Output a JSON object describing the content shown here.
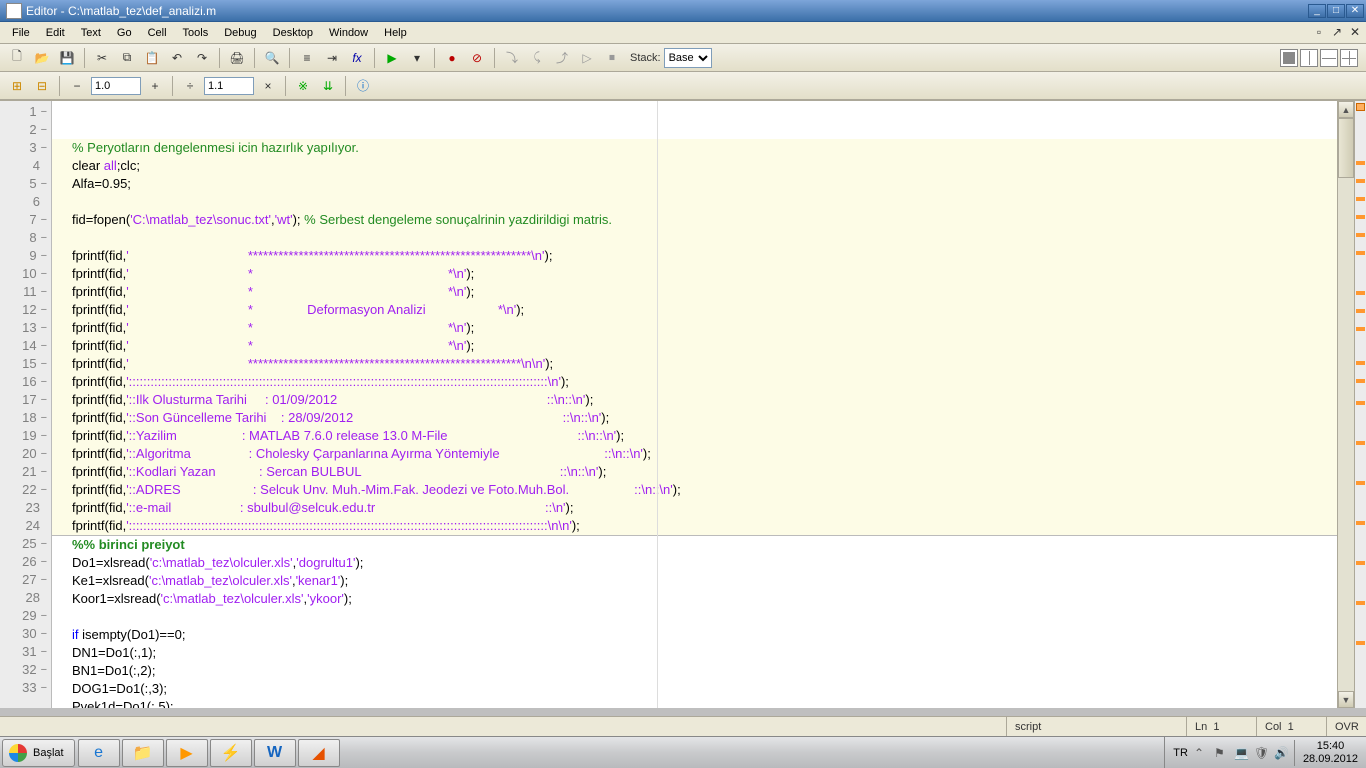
{
  "window": {
    "title": "Editor - C:\\matlab_tez\\def_analizi.m"
  },
  "menu": {
    "items": [
      "File",
      "Edit",
      "Text",
      "Go",
      "Cell",
      "Tools",
      "Debug",
      "Desktop",
      "Window",
      "Help"
    ]
  },
  "toolbar1": {
    "stack_label": "Stack:",
    "stack_value": "Base"
  },
  "toolbar2": {
    "zoom1": "1.0",
    "zoom2": "1.1"
  },
  "gutter": {
    "lines": [
      {
        "n": "1",
        "dash": true
      },
      {
        "n": "2",
        "dash": true
      },
      {
        "n": "3",
        "dash": true
      },
      {
        "n": "4",
        "dash": false
      },
      {
        "n": "5",
        "dash": true
      },
      {
        "n": "6",
        "dash": false
      },
      {
        "n": "7",
        "dash": true
      },
      {
        "n": "8",
        "dash": true
      },
      {
        "n": "9",
        "dash": true
      },
      {
        "n": "10",
        "dash": true
      },
      {
        "n": "11",
        "dash": true
      },
      {
        "n": "12",
        "dash": true
      },
      {
        "n": "13",
        "dash": true
      },
      {
        "n": "14",
        "dash": true
      },
      {
        "n": "15",
        "dash": true
      },
      {
        "n": "16",
        "dash": true
      },
      {
        "n": "17",
        "dash": true
      },
      {
        "n": "18",
        "dash": true
      },
      {
        "n": "19",
        "dash": true
      },
      {
        "n": "20",
        "dash": true
      },
      {
        "n": "21",
        "dash": true
      },
      {
        "n": "22",
        "dash": true
      },
      {
        "n": "23",
        "dash": false
      },
      {
        "n": "24",
        "dash": false
      },
      {
        "n": "25",
        "dash": true
      },
      {
        "n": "26",
        "dash": true
      },
      {
        "n": "27",
        "dash": true
      },
      {
        "n": "28",
        "dash": false
      },
      {
        "n": "29",
        "dash": true
      },
      {
        "n": "30",
        "dash": true
      },
      {
        "n": "31",
        "dash": true
      },
      {
        "n": "32",
        "dash": true
      },
      {
        "n": "33",
        "dash": true
      }
    ]
  },
  "code": {
    "l1_comment": "% Peryotların dengelenmesi icin hazırlık yapılıyor.",
    "l2a": "clear ",
    "l2b": "all",
    "l2c": ";clc;",
    "l3": "Alfa=0.95;",
    "l5a": "fid=fopen(",
    "l5b": "'C:\\matlab_tez\\sonuc.txt'",
    "l5c": ",",
    "l5d": "'wt'",
    "l5e": "); ",
    "l5f": "% Serbest dengeleme sonuçalrinin yazdirildigi matris.",
    "fp_open": "fprintf(fid,",
    "fp_close": ");",
    "s7": "'                                 ********************************************************\\n'",
    "s8": "'                                 *                                                      *\\n'",
    "s9": "'                                 *                                                      *\\n'",
    "s10": "'                                 *               Deformasyon Analizi                    *\\n'",
    "s11": "'                                 *                                                      *\\n'",
    "s12": "'                                 *                                                      *\\n'",
    "s13": "'                                 ******************************************************\\n\\n'",
    "s14": "'::::::::::::::::::::::::::::::::::::::::::::::::::::::::::::::::::::::::::::::::::::::::::::::::::::::::::::::::::::\\n'",
    "s15": "'::Ilk Olusturma Tarihi     : 01/09/2012                                                          ::\\n::\\n'",
    "s16": "'::Son Güncelleme Tarihi    : 28/09/2012                                                          ::\\n::\\n'",
    "s17": "'::Yazilim                  : MATLAB 7.6.0 release 13.0 M-File                                    ::\\n::\\n'",
    "s18": "'::Algoritma                : Cholesky Çarpanlarına Ayırma Yöntemiyle                             ::\\n::\\n'",
    "s19": "'::Kodlari Yazan            : Sercan BULBUL                                                       ::\\n::\\n'",
    "s20": "'::ADRES                    : Selcuk Unv. Muh.-Mim.Fak. Jeodezi ve Foto.Muh.Bol.                  ::\\n::\\n'",
    "s21": "'::e-mail                   : sbulbul@selcuk.edu.tr                                               ::\\n'",
    "s22": "'::::::::::::::::::::::::::::::::::::::::::::::::::::::::::::::::::::::::::::::::::::::::::::::::::::::::::::::::::::\\n\\n'",
    "l24": "%% birinci preiyot",
    "l25a": "Do1=xlsread(",
    "l25b": "'c:\\matlab_tez\\olculer.xls'",
    "l25c": ",",
    "l25d": "'dogrultu1'",
    "l25e": ");",
    "l26a": "Ke1=xlsread(",
    "l26b": "'c:\\matlab_tez\\olculer.xls'",
    "l26c": ",",
    "l26d": "'kenar1'",
    "l26e": ");",
    "l27a": "Koor1=xlsread(",
    "l27b": "'c:\\matlab_tez\\olculer.xls'",
    "l27c": ",",
    "l27d": "'ykoor'",
    "l27e": ");",
    "l29a": "if ",
    "l29b": "isempty(Do1)==0;",
    "l30": "DN1=Do1(:,1);",
    "l31": "BN1=Do1(:,2);",
    "l32": "DOG1=Do1(:,3);",
    "l33": "Pvek1d=Do1(:,5);"
  },
  "status": {
    "type": "script",
    "ln_label": "Ln",
    "ln_val": "1",
    "col_label": "Col",
    "col_val": "1",
    "ovr": "OVR"
  },
  "taskbar": {
    "start": "Başlat",
    "lang": "TR",
    "time": "15:40",
    "date": "28.09.2012"
  }
}
